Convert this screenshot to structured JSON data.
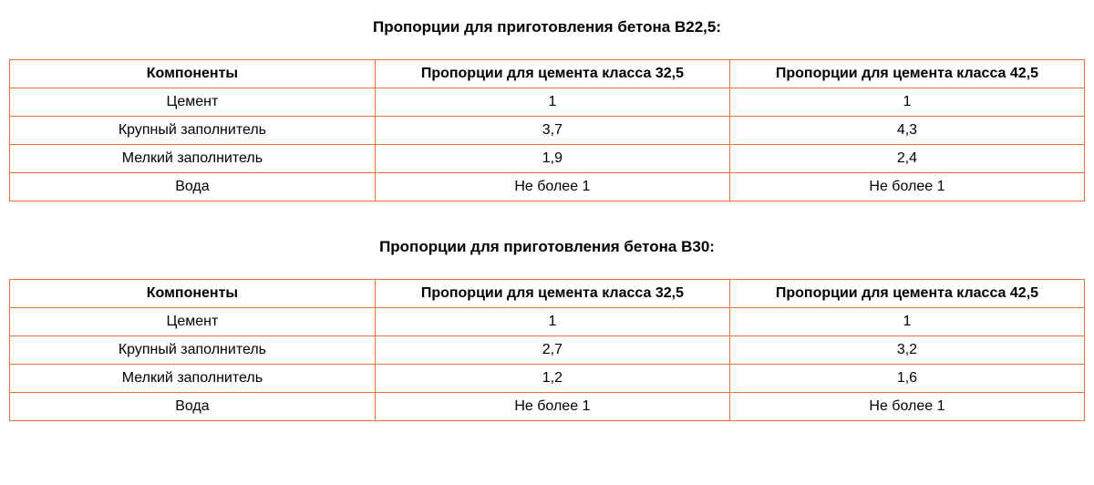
{
  "tables": [
    {
      "title": "Пропорции для приготовления бетона В22,5:",
      "headers": [
        "Компоненты",
        "Пропорции для цемента класса 32,5",
        "Пропорции для цемента класса 42,5"
      ],
      "rows": [
        [
          "Цемент",
          "1",
          "1"
        ],
        [
          "Крупный заполнитель",
          "3,7",
          "4,3"
        ],
        [
          "Мелкий заполнитель",
          "1,9",
          "2,4"
        ],
        [
          "Вода",
          "Не более 1",
          "Не более 1"
        ]
      ]
    },
    {
      "title": "Пропорции для приготовления бетона В30:",
      "headers": [
        "Компоненты",
        "Пропорции для цемента класса 32,5",
        "Пропорции для цемента класса 42,5"
      ],
      "rows": [
        [
          "Цемент",
          "1",
          "1"
        ],
        [
          "Крупный заполнитель",
          "2,7",
          "3,2"
        ],
        [
          "Мелкий заполнитель",
          "1,2",
          "1,6"
        ],
        [
          "Вода",
          "Не более 1",
          "Не более 1"
        ]
      ]
    }
  ]
}
